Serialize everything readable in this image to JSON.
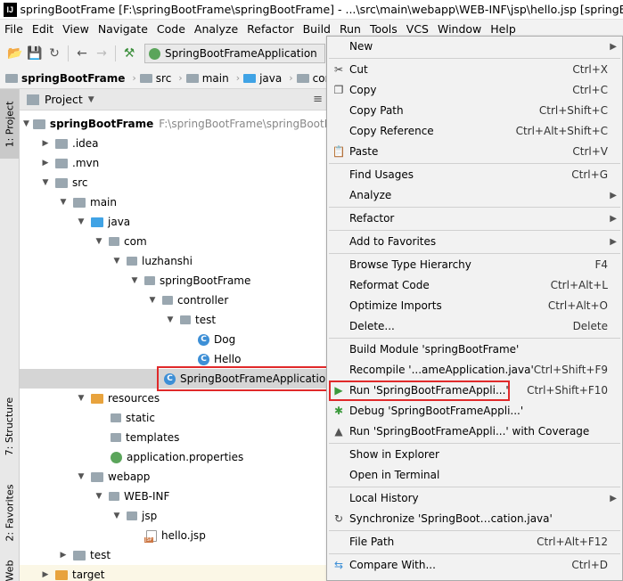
{
  "titlebar": {
    "title": "springBootFrame [F:\\springBootFrame\\springBootFrame] - ...\\src\\main\\webapp\\WEB-INF\\jsp\\hello.jsp [springBootFrame]"
  },
  "menubar": [
    "File",
    "Edit",
    "View",
    "Navigate",
    "Code",
    "Analyze",
    "Refactor",
    "Build",
    "Run",
    "Tools",
    "VCS",
    "Window",
    "Help"
  ],
  "toolbar": {
    "run_config": "SpringBootFrameApplication"
  },
  "breadcrumb": [
    "springBootFrame",
    "src",
    "main",
    "java",
    "com"
  ],
  "sidestrip": {
    "project": "1: Project",
    "structure": "7: Structure",
    "favorites": "2: Favorites",
    "web": "Web"
  },
  "project": {
    "header": "Project",
    "root_path": "F:\\springBootFrame\\springBootFrame",
    "tree": [
      "springBootFrame",
      ".idea",
      ".mvn",
      "src",
      "main",
      "java",
      "com",
      "luzhanshi",
      "springBootFrame",
      "controller",
      "test",
      "Dog",
      "Hello",
      "SpringBootFrameApplication",
      "resources",
      "static",
      "templates",
      "application.properties",
      "webapp",
      "WEB-INF",
      "jsp",
      "hello.jsp",
      "test",
      "target"
    ]
  },
  "context_menu": {
    "new": "New",
    "cut": "Cut",
    "cut_sc": "Ctrl+X",
    "copy": "Copy",
    "copy_sc": "Ctrl+C",
    "copy_path": "Copy Path",
    "copy_path_sc": "Ctrl+Shift+C",
    "copy_ref": "Copy Reference",
    "copy_ref_sc": "Ctrl+Alt+Shift+C",
    "paste": "Paste",
    "paste_sc": "Ctrl+V",
    "find_usages": "Find Usages",
    "find_usages_sc": "Ctrl+G",
    "analyze": "Analyze",
    "refactor": "Refactor",
    "add_fav": "Add to Favorites",
    "browse_hier": "Browse Type Hierarchy",
    "browse_hier_sc": "F4",
    "reformat": "Reformat Code",
    "reformat_sc": "Ctrl+Alt+L",
    "optimize": "Optimize Imports",
    "optimize_sc": "Ctrl+Alt+O",
    "delete": "Delete...",
    "delete_sc": "Delete",
    "build_module": "Build Module 'springBootFrame'",
    "recompile": "Recompile '...ameApplication.java'",
    "recompile_sc": "Ctrl+Shift+F9",
    "run": "Run 'SpringBootFrameAppli...'",
    "run_sc": "Ctrl+Shift+F10",
    "debug": "Debug 'SpringBootFrameAppli...'",
    "coverage": "Run 'SpringBootFrameAppli...' with Coverage",
    "show_explorer": "Show in Explorer",
    "open_terminal": "Open in Terminal",
    "local_history": "Local History",
    "synchronize": "Synchronize 'SpringBoot…cation.java'",
    "file_path": "File Path",
    "file_path_sc": "Ctrl+Alt+F12",
    "compare": "Compare With...",
    "compare_sc": "Ctrl+D"
  }
}
